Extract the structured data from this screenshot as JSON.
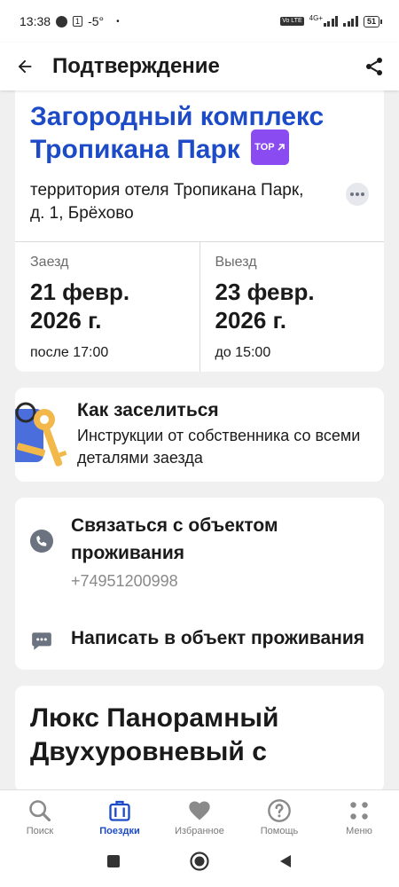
{
  "status_bar": {
    "time": "13:38",
    "notif_box": "1",
    "temperature": "-5°",
    "dot": "•",
    "volte": "Vo LTE",
    "network": "4G+",
    "battery": "51"
  },
  "app_bar": {
    "title": "Подтверждение",
    "back_icon": "arrow-left-icon",
    "share_icon": "share-icon"
  },
  "hotel": {
    "name": "Загородный комплекс Тропикана Парк",
    "badge": "TOP",
    "address": "территория отеля Тропикана Парк, д. 1, Брёхово"
  },
  "checkin": {
    "label": "Заезд",
    "date": "21 февр. 2026 г.",
    "time": "после 17:00"
  },
  "checkout": {
    "label": "Выезд",
    "date": "23 февр. 2026 г.",
    "time": "до 15:00"
  },
  "how_to_checkin": {
    "title": "Как заселиться",
    "description": "Инструкции от собственника со всеми деталями заезда",
    "icon": "keys-icon"
  },
  "contacts": {
    "call_title": "Связаться с объектом проживания",
    "phone": "+74951200998",
    "message_title": "Написать в объект проживания"
  },
  "room": {
    "title": "Люкс Панорамный Двухуровневый с"
  },
  "bottom_nav": {
    "items": [
      {
        "label": "Поиск",
        "icon": "search-icon"
      },
      {
        "label": "Поездки",
        "icon": "suitcase-icon",
        "active": true
      },
      {
        "label": "Избранное",
        "icon": "heart-icon"
      },
      {
        "label": "Помощь",
        "icon": "help-icon"
      },
      {
        "label": "Меню",
        "icon": "menu-icon"
      }
    ]
  },
  "colors": {
    "brand_blue": "#1d4bc7",
    "badge_purple": "#8a4cf0",
    "nav_active": "#1d4bc7"
  }
}
